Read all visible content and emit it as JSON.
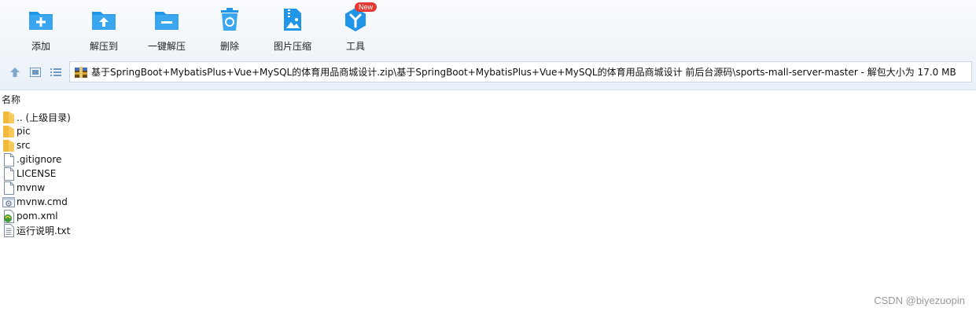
{
  "toolbar": {
    "items": [
      {
        "label": "添加",
        "icon": "add-folder-icon"
      },
      {
        "label": "解压到",
        "icon": "extract-to-icon"
      },
      {
        "label": "一键解压",
        "icon": "one-click-extract-icon"
      },
      {
        "label": "删除",
        "icon": "delete-icon"
      },
      {
        "label": "图片压缩",
        "icon": "image-compress-icon"
      },
      {
        "label": "工具",
        "icon": "tools-icon",
        "badge": "New"
      }
    ]
  },
  "nav": {
    "up_icon": "up-arrow-icon",
    "thumbnail_view_icon": "thumbnail-view-icon",
    "list_view_icon": "list-view-icon"
  },
  "address": {
    "path": "基于SpringBoot+MybatisPlus+Vue+MySQL的体育用品商城设计.zip\\基于SpringBoot+MybatisPlus+Vue+MySQL的体育用品商城设计 前后台源码\\sports-mall-server-master - 解包大小为 17.0 MB"
  },
  "list": {
    "column_header": "名称",
    "items": [
      {
        "name": ".. (上级目录)",
        "type": "parent-folder"
      },
      {
        "name": "pic",
        "type": "folder"
      },
      {
        "name": "src",
        "type": "folder"
      },
      {
        "name": ".gitignore",
        "type": "file"
      },
      {
        "name": "LICENSE",
        "type": "file"
      },
      {
        "name": "mvnw",
        "type": "file"
      },
      {
        "name": "mvnw.cmd",
        "type": "cmd"
      },
      {
        "name": "pom.xml",
        "type": "xml"
      },
      {
        "name": "运行说明.txt",
        "type": "text"
      }
    ]
  },
  "watermark": "CSDN @biyezuopin",
  "colors": {
    "accent_blue": "#2196e8",
    "folder_yellow": "#f7c95a",
    "badge_red": "#e53935"
  }
}
